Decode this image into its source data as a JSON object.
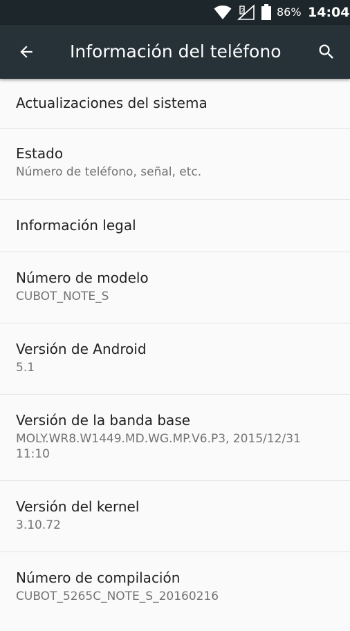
{
  "status_bar": {
    "battery_percent": "86%",
    "time": "14:04",
    "icons": [
      "wifi-icon",
      "signal-icon",
      "battery-icon"
    ]
  },
  "toolbar": {
    "title": "Información del teléfono",
    "back_icon": "arrow-back-icon",
    "search_icon": "search-icon"
  },
  "items": [
    {
      "title": "Actualizaciones del sistema",
      "summary": ""
    },
    {
      "title": "Estado",
      "summary": "Número de teléfono, señal, etc."
    },
    {
      "title": "Información legal",
      "summary": ""
    },
    {
      "title": "Número de modelo",
      "summary": "CUBOT_NOTE_S"
    },
    {
      "title": "Versión de Android",
      "summary": "5.1"
    },
    {
      "title": "Versión de la banda base",
      "summary": "MOLY.WR8.W1449.MD.WG.MP.V6.P3, 2015/12/31 11:10"
    },
    {
      "title": "Versión del kernel",
      "summary": "3.10.72"
    },
    {
      "title": "Número de compilación",
      "summary": "CUBOT_5265C_NOTE_S_20160216"
    }
  ],
  "colors": {
    "status_bar": "#1d262b",
    "toolbar": "#263238",
    "background": "#fafafa",
    "primary_text": "#212121",
    "secondary_text": "#737373",
    "divider": "#e3e3e3"
  }
}
